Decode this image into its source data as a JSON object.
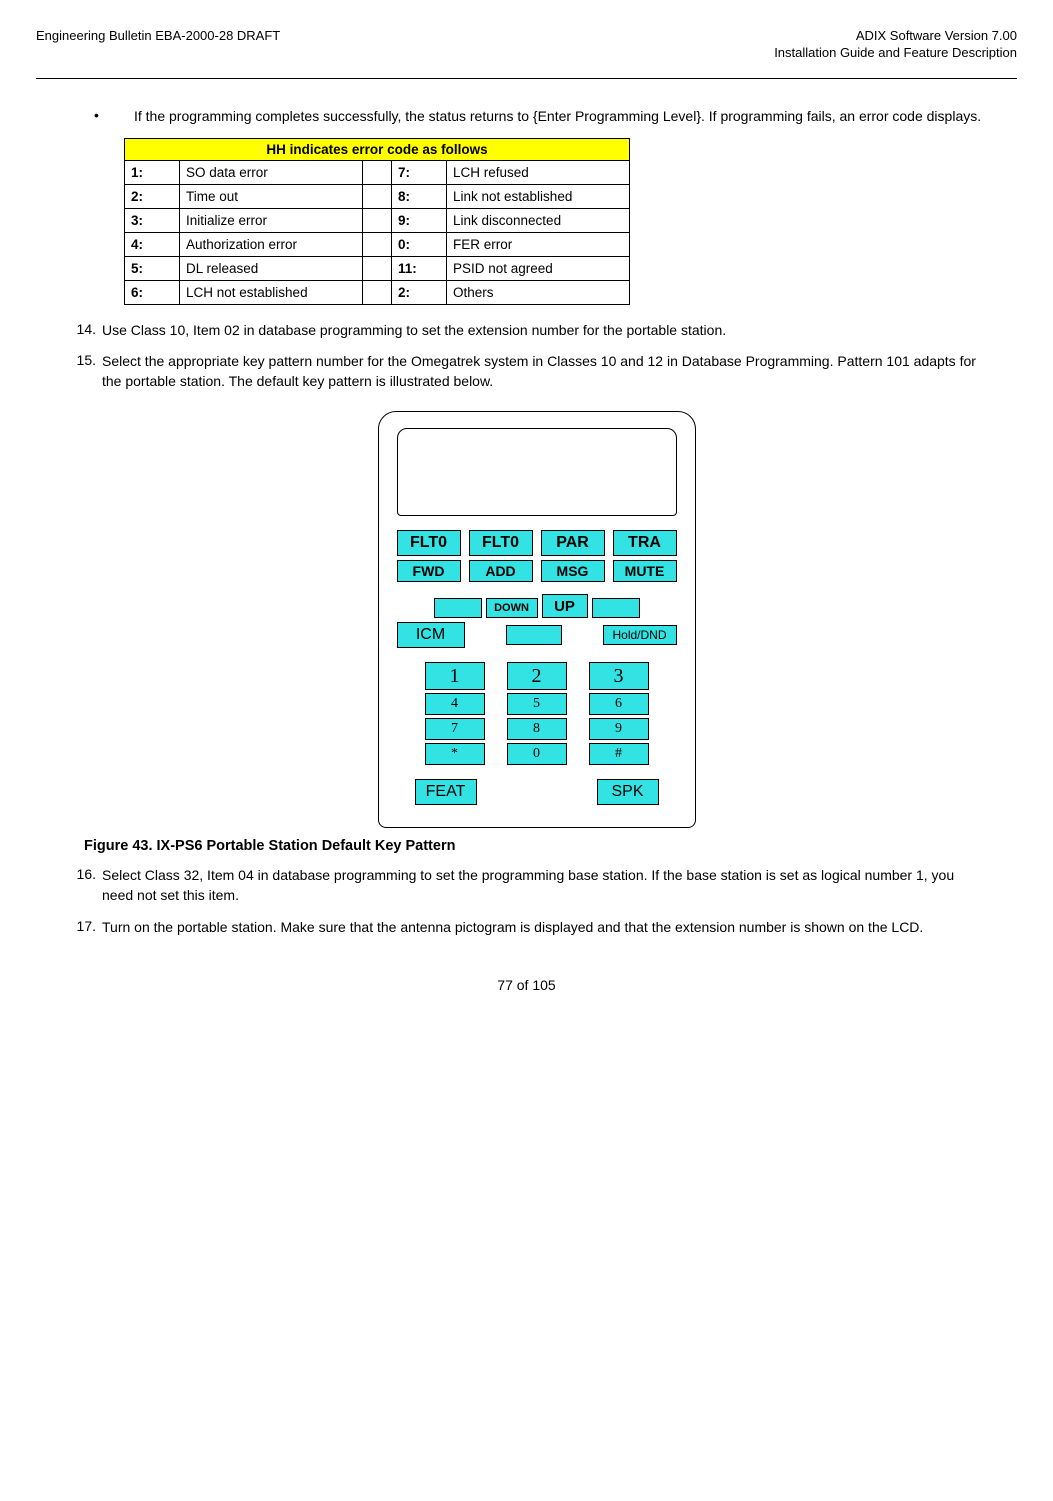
{
  "header": {
    "left": "Engineering Bulletin EBA-2000-28 DRAFT",
    "right1": "ADIX Software Version 7.00",
    "right2": "Installation Guide and Feature Description"
  },
  "bullet": "If the programming completes successfully, the status returns to {Enter Programming Level}. If programming fails, an error code displays.",
  "table": {
    "title": "HH indicates error code as follows",
    "rows": [
      {
        "c1": "1:",
        "d1": "SO data error",
        "c2": "7:",
        "d2": "LCH refused"
      },
      {
        "c1": "2:",
        "d1": "Time out",
        "c2": "8:",
        "d2": "Link not established"
      },
      {
        "c1": "3:",
        "d1": "Initialize error",
        "c2": "9:",
        "d2": "Link disconnected"
      },
      {
        "c1": "4:",
        "d1": "Authorization error",
        "c2": "0:",
        "d2": "FER error"
      },
      {
        "c1": "5:",
        "d1": "DL released",
        "c2": "11:",
        "d2": "PSID not agreed"
      },
      {
        "c1": "6:",
        "d1": "LCH not established",
        "c2": "2:",
        "d2": " Others"
      }
    ]
  },
  "step14": {
    "num": "14.",
    "text": "Use Class 10, Item 02 in database programming to set the extension number for the portable station."
  },
  "step15": {
    "num": "15.",
    "text": "Select the appropriate key pattern number for the Omegatrek system in Classes 10 and 12 in Database Programming.  Pattern 101 adapts for the portable station.  The default key pattern is illustrated below."
  },
  "device": {
    "row1": [
      "FLT0",
      "FLT0",
      "PAR",
      "TRA"
    ],
    "row2": [
      "FWD",
      "ADD",
      "MSG",
      "MUTE"
    ],
    "down": "DOWN",
    "up": "UP",
    "icm": "ICM",
    "hold": "Hold/DND",
    "dial": [
      [
        "1",
        "2",
        "3"
      ],
      [
        "4",
        "5",
        "6"
      ],
      [
        "7",
        "8",
        "9"
      ],
      [
        "*",
        "0",
        "#"
      ]
    ],
    "feat": "FEAT",
    "spk": "SPK"
  },
  "figcaption": "Figure 43.  IX-PS6 Portable Station Default Key Pattern",
  "step16": {
    "num": "16.",
    "text": "Select Class 32, Item 04 in database programming to set the programming base station.  If the base station is set as logical number 1, you need not set this item."
  },
  "step17": {
    "num": "17.",
    "text": "Turn on the portable station.  Make sure that the antenna pictogram is displayed and that the extension number is shown on the LCD."
  },
  "footer": "77 of 105"
}
